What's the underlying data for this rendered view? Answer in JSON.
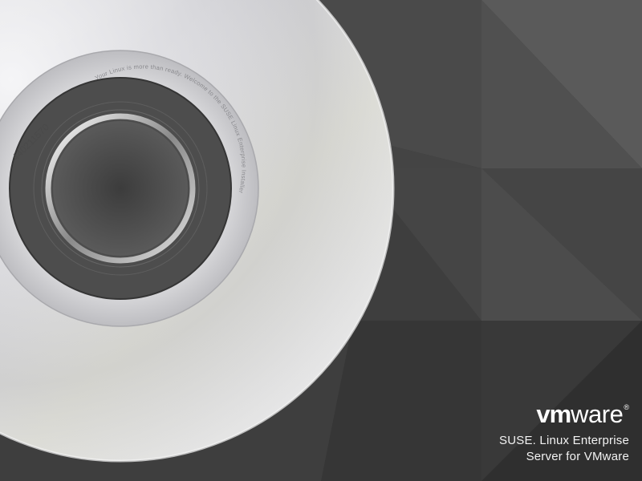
{
  "logo": {
    "vm": "vm",
    "ware": "ware",
    "registered": "®"
  },
  "product": {
    "line1": "SUSE. Linux Enterprise",
    "line2": "Server for VMware"
  },
  "disc": {
    "serial": "440211570",
    "ring_text": "Your Linux is more than ready. Welcome to the SUSE Linux Enterprise Installer"
  },
  "colors": {
    "background": "#404040",
    "text": "#ffffff",
    "disc_silver": "#d9d9dc",
    "hub_dark": "#4a4a4a"
  }
}
